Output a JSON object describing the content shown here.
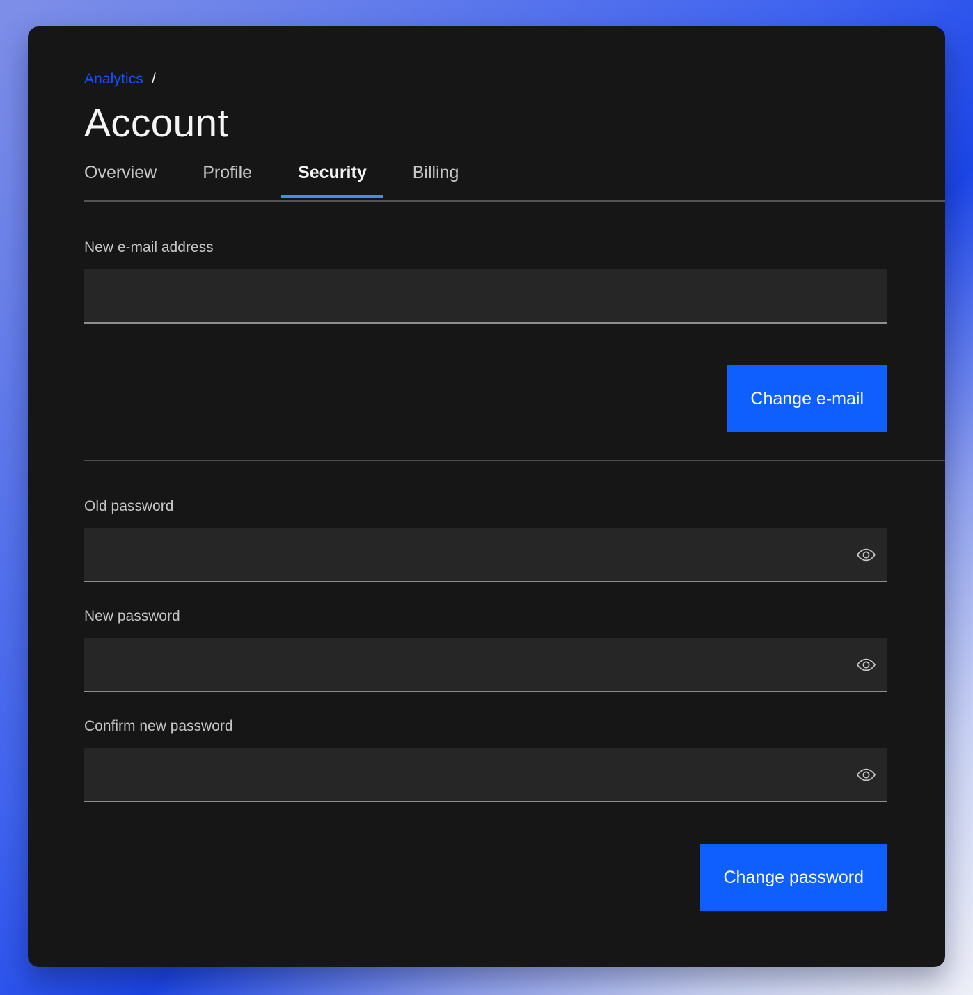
{
  "theme": {
    "card_bg": "#161616",
    "accent_blue": "#0f5ffe",
    "link_blue": "#1353ff",
    "tab_active_underline": "#4589ff",
    "input_bg": "#262626",
    "input_border": "#8d8d8d",
    "label_color": "#c6c6c6",
    "divider": "#4d4d4d"
  },
  "breadcrumb": {
    "link_label": "Analytics",
    "separator": "/"
  },
  "header": {
    "title": "Account"
  },
  "tabs": [
    {
      "label": "Overview",
      "active": false
    },
    {
      "label": "Profile",
      "active": false
    },
    {
      "label": "Security",
      "active": true
    },
    {
      "label": "Billing",
      "active": false
    }
  ],
  "email_section": {
    "label": "New e-mail address",
    "value": "",
    "placeholder": "",
    "submit_label": "Change e-mail"
  },
  "password_section": {
    "old_password": {
      "label": "Old password",
      "value": "",
      "placeholder": "",
      "reveal_icon": "eye-icon"
    },
    "new_password": {
      "label": "New password",
      "value": "",
      "placeholder": "",
      "reveal_icon": "eye-icon"
    },
    "confirm_password": {
      "label": "Confirm new password",
      "value": "",
      "placeholder": "",
      "reveal_icon": "eye-icon"
    },
    "submit_label": "Change password"
  }
}
